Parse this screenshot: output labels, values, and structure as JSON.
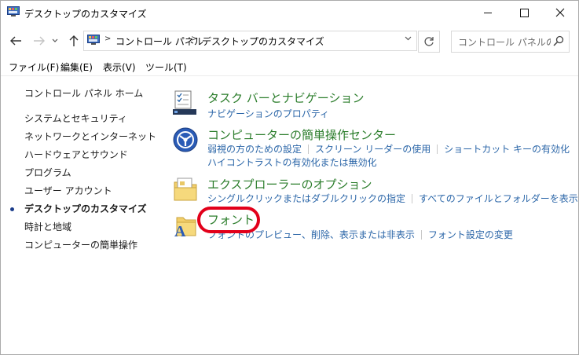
{
  "window": {
    "title": "デスクトップのカスタマイズ"
  },
  "address_bar": {
    "crumbs": [
      "コントロール パネル",
      "デスクトップのカスタマイズ"
    ],
    "search_placeholder": "コントロール パネルの検..."
  },
  "menu": {
    "items": [
      "ファイル(F)",
      "編集(E)",
      "表示(V)",
      "ツール(T)"
    ]
  },
  "left_nav": {
    "items": [
      {
        "label": "コントロール パネル ホーム",
        "current": false
      },
      {
        "label": "システムとセキュリティ",
        "current": false
      },
      {
        "label": "ネットワークとインターネット",
        "current": false
      },
      {
        "label": "ハードウェアとサウンド",
        "current": false
      },
      {
        "label": "プログラム",
        "current": false
      },
      {
        "label": "ユーザー アカウント",
        "current": false
      },
      {
        "label": "デスクトップのカスタマイズ",
        "current": true
      },
      {
        "label": "時計と地域",
        "current": false
      },
      {
        "label": "コンピューターの簡単操作",
        "current": false
      }
    ]
  },
  "categories": [
    {
      "title": "タスク バーとナビゲーション",
      "icon": "taskbar-icon",
      "links": [
        [
          "ナビゲーションのプロパティ"
        ]
      ]
    },
    {
      "title": "コンピューターの簡単操作センター",
      "icon": "ease-of-access-icon",
      "links": [
        [
          "弱視の方のための設定",
          "スクリーン リーダーの使用",
          "ショートカット キーの有効化"
        ],
        [
          "ハイコントラストの有効化または無効化"
        ]
      ]
    },
    {
      "title": "エクスプローラーのオプション",
      "icon": "folder-options-icon",
      "links": [
        [
          "シングルクリックまたはダブルクリックの指定",
          "すべてのファイルとフォルダーを表示"
        ]
      ]
    },
    {
      "title": "フォント",
      "icon": "fonts-icon",
      "highlighted": true,
      "links": [
        [
          "フォントのプレビュー、削除、表示または非表示",
          "フォント設定の変更"
        ]
      ]
    }
  ],
  "colors": {
    "category_title": "#2b7d2b",
    "link": "#2b66a8",
    "highlight_ring": "#e2001a"
  }
}
